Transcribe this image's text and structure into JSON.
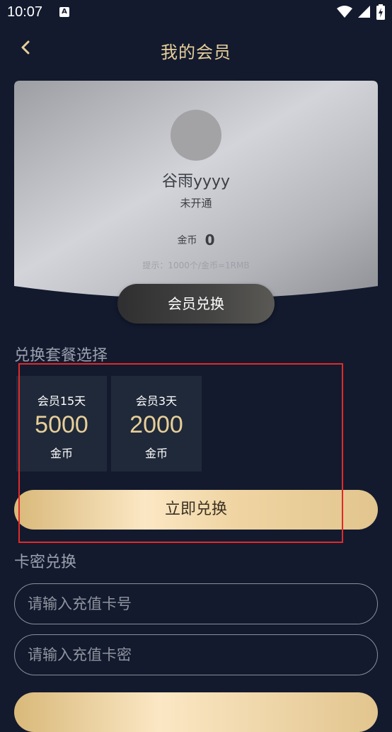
{
  "status_bar": {
    "time": "10:07"
  },
  "header": {
    "title": "我的会员"
  },
  "member_card": {
    "username": "谷雨yyyy",
    "status": "未开通",
    "coins_label": "金币",
    "coins_value": "0",
    "hint": "提示：1000个/金币=1RMB",
    "exchange_button_label": "会员兑换"
  },
  "plans": {
    "section_title": "兑换套餐选择",
    "items": [
      {
        "name": "会员15天",
        "price": "5000",
        "unit": "金币"
      },
      {
        "name": "会员3天",
        "price": "2000",
        "unit": "金币"
      }
    ],
    "redeem_label": "立即兑换"
  },
  "card_redeem": {
    "section_title": "卡密兑换",
    "card_number_placeholder": "请输入充值卡号",
    "card_password_placeholder": "请输入充值卡密"
  },
  "colors": {
    "background": "#131a2e",
    "accent_gold": "#e7cf99",
    "plan_card_bg": "#202939",
    "highlight_red": "#e12a2a"
  }
}
